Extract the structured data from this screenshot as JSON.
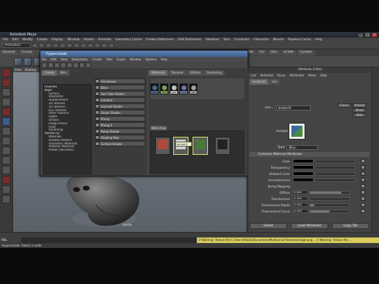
{
  "app": {
    "title": "Autodesk Maya",
    "brand_color": "#3c5f8e"
  },
  "menubar": [
    "File",
    "Edit",
    "Modify",
    "Create",
    "Display",
    "Window",
    "Assets",
    "Animate",
    "Geometry Cache",
    "Create Deformers",
    "Edit Deformers",
    "Skeleton",
    "Skin",
    "Constrain",
    "Character",
    "Muscle",
    "Pipeline Cache",
    "Help"
  ],
  "statusline": {
    "mode": "Animation"
  },
  "shelf_tabs": [
    "General",
    "Curves",
    "Surfaces",
    "Polygons",
    "Subdivs",
    "Deformation",
    "Animation",
    "Dynamics",
    "Rendering",
    "PaintEffects",
    "Toon",
    "Muscle",
    "Fluids",
    "Fur",
    "Hair",
    "nCloth",
    "Custom"
  ],
  "viewport": {
    "menu": [
      "View",
      "Shading",
      "Lighting",
      "Show",
      "Renderer",
      "Panels"
    ],
    "camera_label": "persp"
  },
  "hypershade": {
    "title": "Hypershade",
    "menu": [
      "File",
      "Edit",
      "View",
      "Bookmarks",
      "Create",
      "Tabs",
      "Graph",
      "Window",
      "Options",
      "Help"
    ],
    "left_tabs": [
      "Create",
      "Bins"
    ],
    "tree": [
      {
        "label": "Favorites",
        "cat": true
      },
      {
        "label": "Maya",
        "cat": true
      },
      {
        "label": "Surface",
        "cat": false
      },
      {
        "label": "Volumetric",
        "cat": false
      },
      {
        "label": "Displacement",
        "cat": false
      },
      {
        "label": "2D Textures",
        "cat": false
      },
      {
        "label": "3D Textures",
        "cat": false
      },
      {
        "label": "Env Textures",
        "cat": false
      },
      {
        "label": "Other Textures",
        "cat": false
      },
      {
        "label": "Lights",
        "cat": false
      },
      {
        "label": "Utilities",
        "cat": false
      },
      {
        "label": "Image Planes",
        "cat": false
      },
      {
        "label": "Glow",
        "cat": false
      },
      {
        "label": "Rendering",
        "cat": false
      },
      {
        "label": "mental ray",
        "cat": true
      },
      {
        "label": "Materials",
        "cat": false
      },
      {
        "label": "Shadow Shaders",
        "cat": false
      },
      {
        "label": "Volumetric Materials",
        "cat": false
      },
      {
        "label": "Photonic Materials",
        "cat": false
      },
      {
        "label": "Photon Volumetric",
        "cat": false
      }
    ],
    "nodes": [
      "Anisotropic",
      "Blinn",
      "Hair Tube Shader",
      "Lambert",
      "Layered Shader",
      "Ocean Shader",
      "Phong",
      "Phong E",
      "Ramp Shader",
      "Shading Map",
      "Surface Shader"
    ],
    "right_tabs": [
      "Materials",
      "Textures",
      "Utilities",
      "Rendering"
    ],
    "swatches": [
      {
        "label": "lam",
        "color": "#4a6a8a"
      },
      {
        "label": "lam",
        "color": "#7aa05a"
      },
      {
        "label": "part",
        "color": "#c0c0c0"
      },
      {
        "label": "sha",
        "color": "#6a7aa0"
      },
      {
        "label": "sha",
        "color": "#9aa0a8"
      }
    ],
    "work_tab": "Work Area",
    "tooltip": "lambert2"
  },
  "attribute_editor": {
    "title": "Attribute Editor",
    "menu": [
      "List",
      "Selected",
      "Focus",
      "Attributes",
      "Show",
      "Help"
    ],
    "tabs": [
      "lambert2",
      "lam"
    ],
    "name_label": "lam...",
    "name_value": "lambert2",
    "focus_btn": "Focus",
    "presets_btn": "Presets",
    "show_btn": "Show",
    "hide_btn": "Hide",
    "sample_label": "Sample",
    "type_label": "Type",
    "type_value": "Blinn",
    "section_label": "Common Material Attributes",
    "attrs": [
      {
        "name": "Color",
        "value": "",
        "fill": 0,
        "kind": "color"
      },
      {
        "name": "Transparency",
        "value": "",
        "fill": 0,
        "kind": "color"
      },
      {
        "name": "Ambient Color",
        "value": "",
        "fill": 0,
        "kind": "color"
      },
      {
        "name": "Incandescence",
        "value": "",
        "fill": 0,
        "kind": "color"
      },
      {
        "name": "Bump Mapping",
        "value": "",
        "fill": 0,
        "kind": "label"
      },
      {
        "name": "Diffuse",
        "value": "0.800",
        "fill": 0.8,
        "kind": "slider"
      },
      {
        "name": "Translucence",
        "value": "0.000",
        "fill": 0,
        "kind": "slider"
      },
      {
        "name": "Translucence Depth",
        "value": "0.500",
        "fill": 0.1,
        "kind": "slider"
      },
      {
        "name": "Translucence Focus",
        "value": "0.500",
        "fill": 0.5,
        "kind": "slider"
      }
    ],
    "buttons": [
      "Select",
      "Load Attributes",
      "Copy Tab"
    ]
  },
  "cmdline": {
    "label": "MEL"
  },
  "warning": "// Warning: Texture file C:/Users/Public/Documents/Multiverse/Textures/image.png ...  // Warning: Texture file ...",
  "help_line": "Hypershade: Select a node"
}
